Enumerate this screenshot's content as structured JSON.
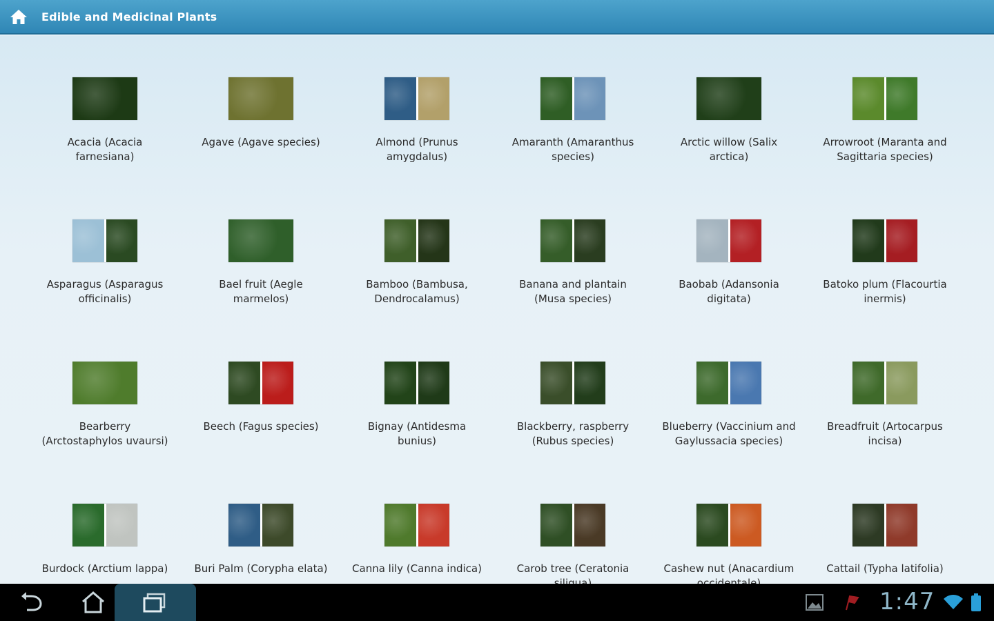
{
  "app_title": "Edible and Medicinal Plants",
  "plants": [
    {
      "label": "Acacia (Acacia farnesiana)",
      "colors": [
        "#1d3a15"
      ]
    },
    {
      "label": "Agave (Agave species)",
      "colors": [
        "#6e7230"
      ]
    },
    {
      "label": "Almond (Prunus amygdalus)",
      "colors": [
        "#2f5d86",
        "#b2a06a"
      ]
    },
    {
      "label": "Amaranth (Amaranthus species)",
      "colors": [
        "#2f5e25",
        "#6d93b8"
      ]
    },
    {
      "label": "Arctic willow (Salix arctica)",
      "colors": [
        "#203f19"
      ]
    },
    {
      "label": "Arrowroot (Maranta and Sagittaria species)",
      "colors": [
        "#5b8a2c",
        "#3f7a2a"
      ]
    },
    {
      "label": "Asparagus (Asparagus officinalis)",
      "colors": [
        "#9cc0d6",
        "#2a4a22"
      ]
    },
    {
      "label": "Bael fruit (Aegle marmelos)",
      "colors": [
        "#2f5f2a"
      ]
    },
    {
      "label": "Bamboo (Bambusa, Dendrocalamus)",
      "colors": [
        "#3f5f2a",
        "#243518"
      ]
    },
    {
      "label": "Banana and plantain (Musa species)",
      "colors": [
        "#355d29",
        "#2a3d20"
      ]
    },
    {
      "label": "Baobab (Adansonia digitata)",
      "colors": [
        "#a4b4bf",
        "#b32024"
      ]
    },
    {
      "label": "Batoko plum (Flacourtia inermis)",
      "colors": [
        "#213a1b",
        "#a51d22"
      ]
    },
    {
      "label": "Bearberry (Arctostaphylos uvaursi)",
      "colors": [
        "#4f7c2c"
      ]
    },
    {
      "label": "Beech (Fagus species)",
      "colors": [
        "#2e4a22",
        "#bb1d1b"
      ]
    },
    {
      "label": "Bignay (Antidesma bunius)",
      "colors": [
        "#224419",
        "#1f3a18"
      ]
    },
    {
      "label": "Blackberry, raspberry (Rubus species)",
      "colors": [
        "#3a4e2a",
        "#223d1b"
      ]
    },
    {
      "label": "Blueberry (Vaccinium and Gaylussacia species)",
      "colors": [
        "#3d6a2c",
        "#4a78b0"
      ]
    },
    {
      "label": "Breadfruit (Artocarpus incisa)",
      "colors": [
        "#3f6a2a",
        "#8a9a5e"
      ]
    },
    {
      "label": "Burdock (Arctium lappa)",
      "colors": [
        "#2a6b2c",
        "#c0c4c0"
      ]
    },
    {
      "label": "Buri Palm (Corypha elata)",
      "colors": [
        "#2f5d86",
        "#3d4a2a"
      ]
    },
    {
      "label": "Canna lily (Canna indica)",
      "colors": [
        "#4f7a2c",
        "#c83a2a"
      ]
    },
    {
      "label": "Carob tree (Ceratonia siliqua)",
      "colors": [
        "#2f4f25",
        "#4a3a26"
      ]
    },
    {
      "label": "Cashew nut (Anacardium occidentale)",
      "colors": [
        "#2b4a20",
        "#cc5a22"
      ]
    },
    {
      "label": "Cattail (Typha latifolia)",
      "colors": [
        "#2d3a24",
        "#8f3a2a"
      ]
    }
  ],
  "status_bar": {
    "time": "1:47"
  }
}
